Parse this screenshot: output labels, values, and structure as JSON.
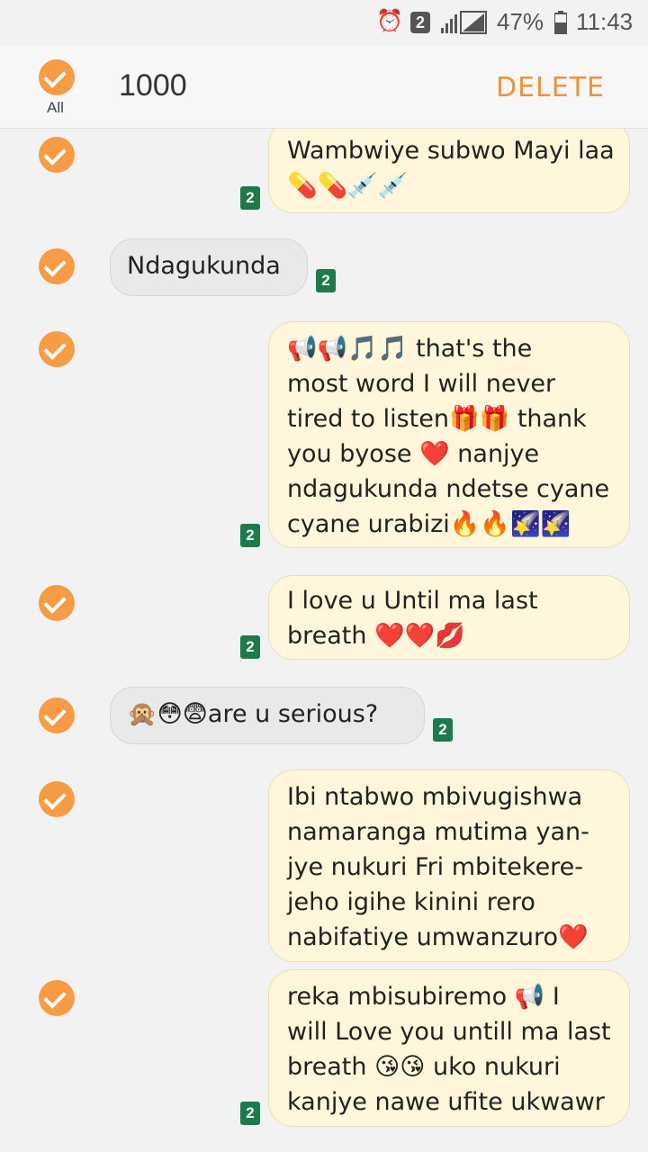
{
  "status_bar": {
    "alarm_icon": "alarm-clock-icon",
    "notif_count": "2",
    "battery": "47%",
    "time": "11:43"
  },
  "header": {
    "select_all_label": "All",
    "title": "1000",
    "delete_label": "DELETE"
  },
  "messages": [
    {
      "type": "sent",
      "sim": "2",
      "lines": [
        "Wambwiye subwo Mayi laa",
        "💊💊💉💉"
      ]
    },
    {
      "type": "received",
      "sim": "2",
      "lines": [
        "Ndagukunda"
      ]
    },
    {
      "type": "sent",
      "sim": "2",
      "lines": [
        "📢📢🎵🎵 that's the",
        "most word I will never",
        "tired to listen🎁🎁 thank",
        "you byose ❤️ nanjye",
        "ndagukunda ndetse cyane",
        "cyane urabizi🔥🔥🌠🌠"
      ]
    },
    {
      "type": "sent",
      "sim": "2",
      "lines": [
        "I love u Until ma last",
        "breath ❤️❤️💋"
      ]
    },
    {
      "type": "received",
      "sim": "2",
      "lines": [
        "🙊😳😨are u serious?"
      ]
    },
    {
      "type": "sent",
      "sim": "",
      "lines": [
        "Ibi ntabwo mbivugishwa",
        "namaranga mutima yan-",
        "jye nukuri Fri mbitekere-",
        "jeho igihe kinini rero",
        "nabifatiye umwanzuro❤️"
      ]
    },
    {
      "type": "sent",
      "sim": "2",
      "lines": [
        "reka mbisubiremo 📢 I",
        "will Love you untill ma last",
        "breath 😘😘 uko nukuri",
        "kanjye nawe ufite ukwawr"
      ]
    }
  ]
}
